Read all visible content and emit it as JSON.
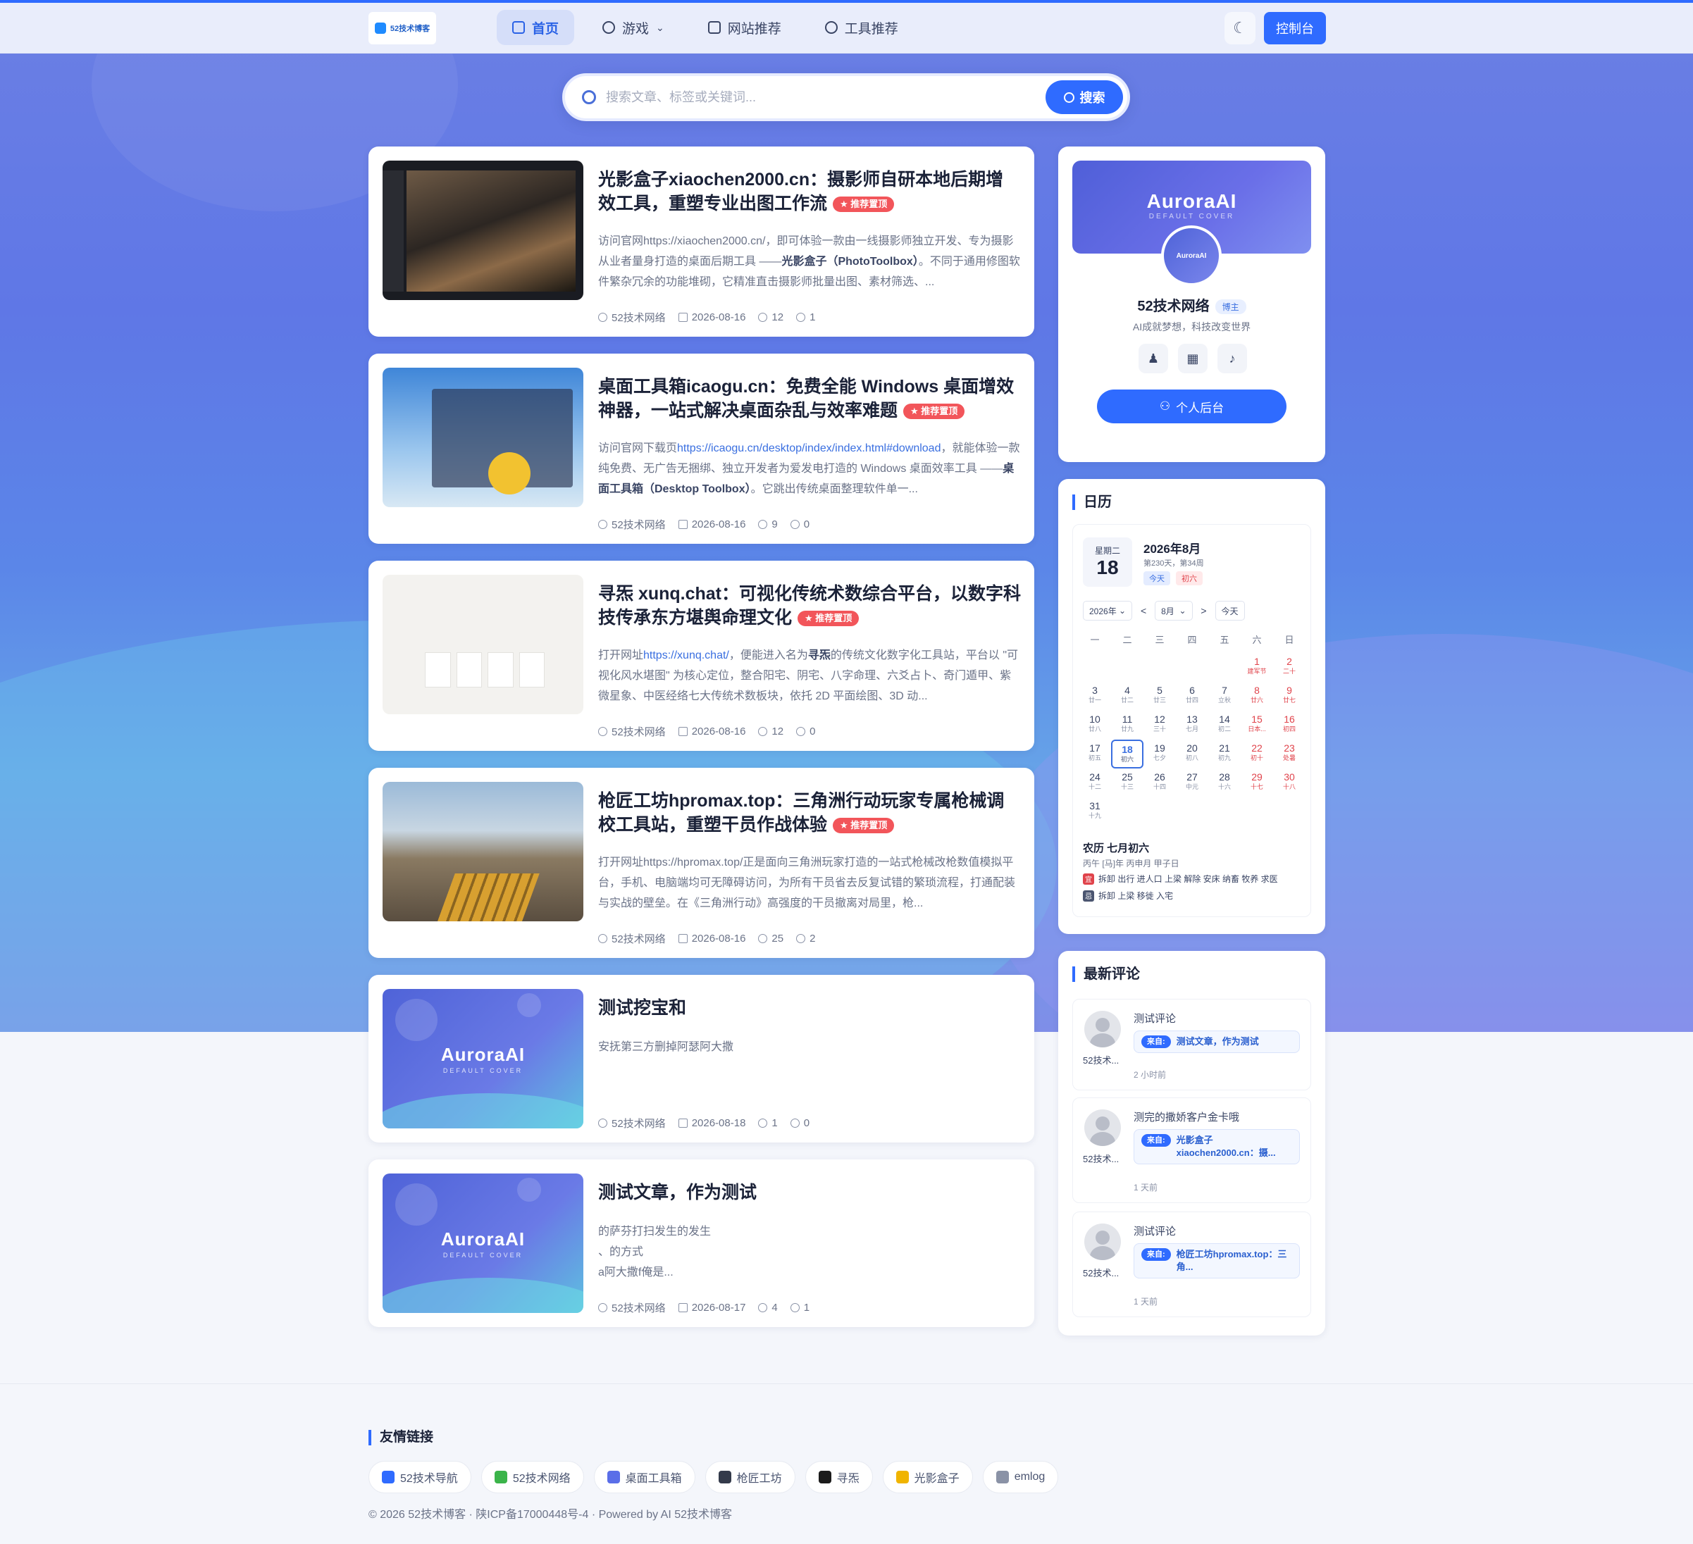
{
  "brand": {
    "logo_text": "52技术博客"
  },
  "nav": {
    "items": [
      {
        "label": "首页",
        "icon": "home-icon",
        "active": true
      },
      {
        "label": "游戏",
        "icon": "gamepad-icon",
        "dropdown": "⌄"
      },
      {
        "label": "网站推荐",
        "icon": "browser-icon"
      },
      {
        "label": "工具推荐",
        "icon": "tools-icon"
      }
    ],
    "theme_glyph": "☾",
    "console_label": "控制台"
  },
  "search": {
    "placeholder": "搜索文章、标签或关键词...",
    "button_label": "搜索"
  },
  "articles": [
    {
      "title": "光影盒子xiaochen2000.cn：摄影师自研本地后期增效工具，重塑专业出图工作流",
      "badge": "★ 推荐置顶",
      "excerpt_pre": "访问官网https://xiaochen2000.cn/，即可体验一款由一线摄影师独立开发、专为摄影从业者量身打造的桌面后期工具 ——",
      "excerpt_strong": "光影盒子（PhotoToolbox）",
      "excerpt_post": "。不同于通用修图软件繁杂冗余的功能堆砌，它精准直击摄影师批量出图、素材筛选、...",
      "author": "52技术网络",
      "date": "2026-08-16",
      "views": "12",
      "comments": "1"
    },
    {
      "title": "桌面工具箱icaogu.cn：免费全能 Windows 桌面增效神器，一站式解决桌面杂乱与效率难题",
      "badge": "★ 推荐置顶",
      "excerpt_pre": "访问官网下载页",
      "excerpt_link": "https://icaogu.cn/desktop/index/index.html#download",
      "excerpt_mid": "，就能体验一款纯免费、无广告无捆绑、独立开发者为爱发电打造的 Windows 桌面效率工具 ——",
      "excerpt_strong": "桌面工具箱（Desktop Toolbox）",
      "excerpt_post": "。它跳出传统桌面整理软件单一...",
      "author": "52技术网络",
      "date": "2026-08-16",
      "views": "9",
      "comments": "0"
    },
    {
      "title": "寻炁 xunq.chat：可视化传统术数综合平台，以数字科技传承东方堪舆命理文化",
      "badge": "★ 推荐置顶",
      "excerpt_pre": "打开网址",
      "excerpt_link": "https://xunq.chat/",
      "excerpt_mid": "，便能进入名为",
      "excerpt_strong": "寻炁",
      "excerpt_post": "的传统文化数字化工具站，平台以 \"可视化风水堪图\" 为核心定位，整合阳宅、阴宅、八字命理、六爻占卜、奇门遁甲、紫微星象、中医经络七大传统术数板块，依托 2D 平面绘图、3D 动...",
      "author": "52技术网络",
      "date": "2026-08-16",
      "views": "12",
      "comments": "0"
    },
    {
      "title": "枪匠工坊hpromax.top：三角洲行动玩家专属枪械调校工具站，重塑干员作战体验",
      "badge": "★ 推荐置顶",
      "excerpt_pre": "打开网址https://hpromax.top/正是面向三角洲玩家打造的一站式枪械改枪数值模拟平台，手机、电脑端均可无障碍访问，为所有干员省去反复试错的繁琐流程，打通配装与实战的壁垒。在《三角洲行动》高强度的干员撤离对局里，枪...",
      "author": "52技术网络",
      "date": "2026-08-16",
      "views": "25",
      "comments": "2"
    },
    {
      "title": "测试挖宝和",
      "excerpt_pre": "安抚第三方删掉阿瑟阿大撒",
      "cover_title": "AuroraAI",
      "cover_sub": "DEFAULT COVER",
      "author": "52技术网络",
      "date": "2026-08-18",
      "views": "1",
      "comments": "0"
    },
    {
      "title": "测试文章，作为测试",
      "excerpt_lines": [
        "的萨芬打扫发生的发生",
        "、的方式",
        "a阿大撒f俺是..."
      ],
      "cover_title": "AuroraAI",
      "cover_sub": "DEFAULT COVER",
      "author": "52技术网络",
      "date": "2026-08-17",
      "views": "4",
      "comments": "1"
    }
  ],
  "profile": {
    "banner_title": "AuroraAI",
    "banner_sub": "DEFAULT COVER",
    "avatar_text": "AuroraAI",
    "name": "52技术网络",
    "role": "博主",
    "desc": "AI成就梦想，科技改变世界",
    "button_label": "个人后台"
  },
  "calendar": {
    "title": "日历",
    "weekday": "星期二",
    "day": "18",
    "month_label": "2026年8月",
    "sub": "第230天，第34周",
    "tag_today": "今天",
    "tag_lunar": "初六",
    "year_select": "2026年",
    "month_select": "8月",
    "prev": "<",
    "next": ">",
    "today_btn": "今天",
    "weekdays": [
      "一",
      "二",
      "三",
      "四",
      "五",
      "六",
      "日"
    ],
    "weeks": [
      [
        [
          "",
          ""
        ],
        [
          "",
          ""
        ],
        [
          "",
          ""
        ],
        [
          "",
          ""
        ],
        [
          "",
          ""
        ],
        [
          "1",
          "建军节"
        ],
        [
          "2",
          "二十"
        ]
      ],
      [
        [
          "3",
          "廿一"
        ],
        [
          "4",
          "廿二"
        ],
        [
          "5",
          "廿三"
        ],
        [
          "6",
          "廿四"
        ],
        [
          "7",
          "立秋"
        ],
        [
          "8",
          "廿六"
        ],
        [
          "9",
          "廿七"
        ]
      ],
      [
        [
          "10",
          "廿八"
        ],
        [
          "11",
          "廿九"
        ],
        [
          "12",
          "三十"
        ],
        [
          "13",
          "七月"
        ],
        [
          "14",
          "初二"
        ],
        [
          "15",
          "日本..."
        ],
        [
          "16",
          "初四"
        ]
      ],
      [
        [
          "17",
          "初五"
        ],
        [
          "18",
          "初六"
        ],
        [
          "19",
          "七夕"
        ],
        [
          "20",
          "初八"
        ],
        [
          "21",
          "初九"
        ],
        [
          "22",
          "初十"
        ],
        [
          "23",
          "处暑"
        ]
      ],
      [
        [
          "24",
          "十二"
        ],
        [
          "25",
          "十三"
        ],
        [
          "26",
          "十四"
        ],
        [
          "27",
          "中元"
        ],
        [
          "28",
          "十六"
        ],
        [
          "29",
          "十七"
        ],
        [
          "30",
          "十八"
        ]
      ],
      [
        [
          "31",
          "十九"
        ],
        [
          "",
          ""
        ],
        [
          "",
          ""
        ],
        [
          "",
          ""
        ],
        [
          "",
          ""
        ],
        [
          "",
          ""
        ],
        [
          "",
          ""
        ]
      ]
    ],
    "lunar": "农历 七月初六",
    "ganzhi": "丙午 [马]年 丙申月 甲子日",
    "yi_label": "宜",
    "yi": "拆卸 出行 进人口 上梁 解除 安床 纳畜 牧养 求医",
    "ji_label": "忌",
    "ji": "拆卸 上梁 移徙 入宅"
  },
  "comments": {
    "title": "最新评论",
    "items": [
      {
        "author": "52技术...",
        "text": "测试评论",
        "from_label": "来自:",
        "from": "测试文章，作为测试",
        "time": "2 小时前"
      },
      {
        "author": "52技术...",
        "text": "测完的撒娇客户金卡哦",
        "from_label": "来自:",
        "from": "光影盒子xiaochen2000.cn：摄...",
        "time": "1 天前"
      },
      {
        "author": "52技术...",
        "text": "测试评论",
        "from_label": "来自:",
        "from": "枪匠工坊hpromax.top：三角...",
        "time": "1 天前"
      }
    ]
  },
  "footer": {
    "links_title": "友情链接",
    "links": [
      {
        "label": "52技术导航",
        "icon": "52-icon",
        "color": "#2f6bff"
      },
      {
        "label": "52技术网络",
        "icon": "cactus-icon",
        "color": "#3bb44a"
      },
      {
        "label": "桌面工具箱",
        "icon": "toolbox-icon",
        "color": "#5a6ee8"
      },
      {
        "label": "枪匠工坊",
        "icon": "gun-icon",
        "color": "#333a4a"
      },
      {
        "label": "寻炁",
        "icon": "yinyang-icon",
        "color": "#1b1b1b"
      },
      {
        "label": "光影盒子",
        "icon": "camera-icon",
        "color": "#f0b400"
      },
      {
        "label": "emlog",
        "icon": "emlog-icon",
        "color": "#8a92a6"
      }
    ],
    "copyright": "© 2026 52技术博客 · 陕ICP备17000448号-4 · Powered by AI 52技术博客"
  },
  "colors": {
    "accent": "#2f6bff",
    "badge": "#f2555a",
    "weekend": "#e0434b"
  }
}
